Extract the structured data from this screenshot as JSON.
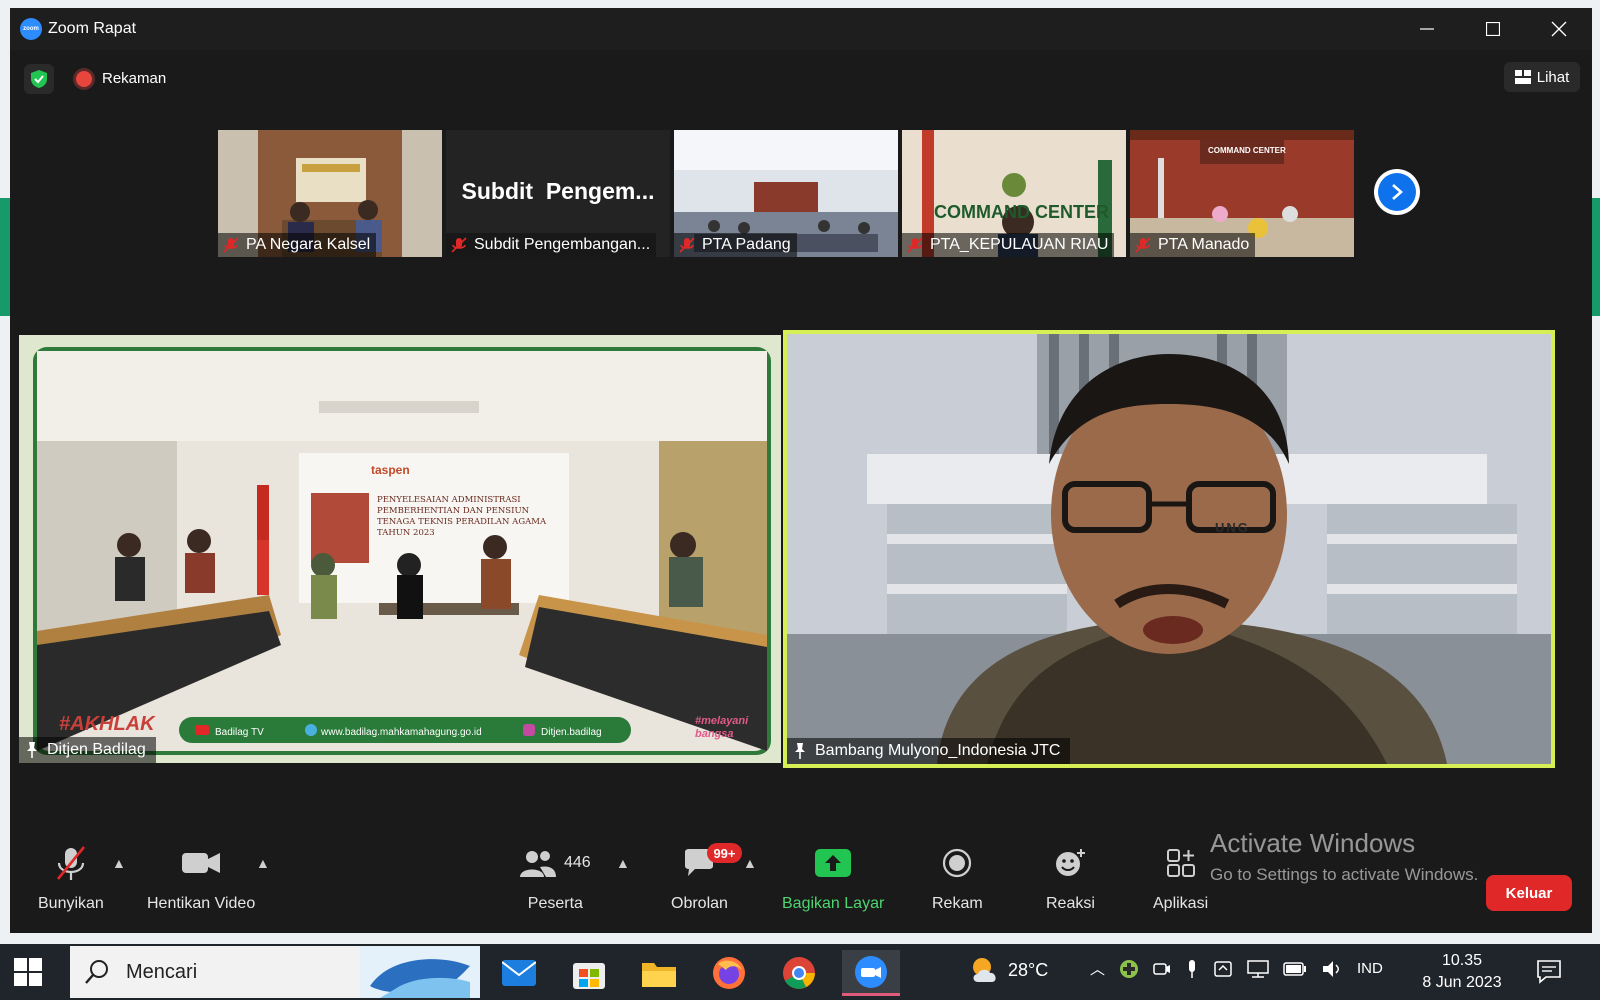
{
  "window": {
    "title": "Zoom Rapat"
  },
  "meeting_header": {
    "recording_label": "Rekaman",
    "view_label": "Lihat"
  },
  "thumbnails": [
    {
      "name": "PA Negara Kalsel"
    },
    {
      "name": "Subdit Pengembangan...",
      "overlay_text": "Subdit  Pengem..."
    },
    {
      "name": "PTA Padang"
    },
    {
      "name": "PTA_KEPULAUAN RIAU",
      "sign_text": "COMMAND CENTER"
    },
    {
      "name": "PTA Manado",
      "sign_text": "COMMAND CENTER"
    }
  ],
  "main_videos": {
    "left": {
      "name": "Ditjen Badilag",
      "banner_title": "PENYELESAIAN ADMINISTRASI PEMBERHENTIAN DAN PENSIUN TENAGA TEKNIS PERADILAN AGAMA TAHUN 2023",
      "banner_logo_text": "taspen",
      "footer": {
        "youtube": "Badilag TV",
        "website": "www.badilag.mahkamahagung.go.id",
        "instagram": "Ditjen.badilag"
      },
      "corner_left": "#AKHLAK",
      "corner_right": "#melayani bangsa"
    },
    "right": {
      "name": "Bambang Mulyono_Indonesia JTC",
      "building_text": "UNG"
    }
  },
  "toolbar": {
    "unmute": "Bunyikan",
    "stop_video": "Hentikan Video",
    "participants": "Peserta",
    "participants_count": "446",
    "chat": "Obrolan",
    "chat_badge": "99+",
    "share_screen": "Bagikan Layar",
    "record": "Rekam",
    "reactions": "Reaksi",
    "apps": "Aplikasi",
    "leave": "Keluar"
  },
  "watermark": {
    "title": "Activate Windows",
    "subtitle": "Go to Settings to activate Windows."
  },
  "taskbar": {
    "search_placeholder": "Mencari",
    "temperature": "28°C",
    "language": "IND",
    "time": "10.35",
    "date": "8 Jun 2023"
  },
  "colors": {
    "zoom_blue": "#0e72ed",
    "active_speaker": "#d6ef55",
    "share_green": "#4ed470",
    "leave_red": "#e02828"
  }
}
